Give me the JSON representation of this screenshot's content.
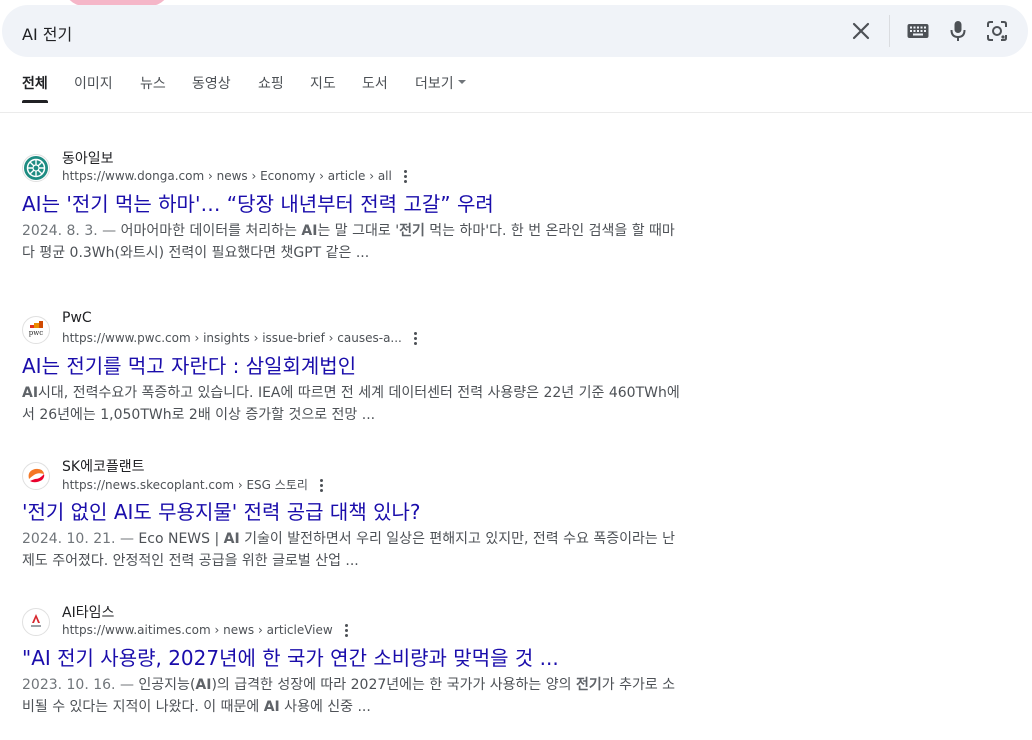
{
  "search": {
    "query": "AI 전기",
    "clear_icon": "close-icon",
    "keyboard_icon": "keyboard-icon",
    "voice_icon": "microphone-icon",
    "lens_icon": "camera-lens-icon"
  },
  "tabs": [
    {
      "label": "전체",
      "active": true
    },
    {
      "label": "이미지"
    },
    {
      "label": "뉴스"
    },
    {
      "label": "동영상"
    },
    {
      "label": "쇼핑"
    },
    {
      "label": "지도"
    },
    {
      "label": "도서"
    },
    {
      "label": "더보기"
    }
  ],
  "results": [
    {
      "site": "동아일보",
      "url_base": "https://www.donga.com",
      "url_path": " › news › Economy › article › all",
      "title": "AI는 '전기 먹는 하마'… “당장 내년부터 전력 고갈” 우려",
      "date": "2024. 8. 3. —",
      "snippet_parts": [
        {
          "t": " 어마어마한 데이터를 처리하는 "
        },
        {
          "t": "AI",
          "b": true
        },
        {
          "t": "는 말 그대로 '"
        },
        {
          "t": "전기",
          "b": true
        },
        {
          "t": " 먹는 하마'다. 한 번 온라인 검색을 할 때마다 평균 0.3Wh(와트시) 전력이 필요했다면 챗GPT 같은 ..."
        }
      ]
    },
    {
      "site": "PwC",
      "url_base": "https://www.pwc.com",
      "url_path": " › insights › issue-brief › causes-a...",
      "title": "AI는 전기를 먹고 자란다 : 삼일회계법인",
      "date": "",
      "snippet_parts": [
        {
          "t": "AI",
          "b": true
        },
        {
          "t": "시대, 전력수요가 폭증하고 있습니다. IEA에 따르면 전 세계 데이터센터 전력 사용량은 22년 기준 460TWh에서 26년에는 1,050TWh로 2배 이상 증가할 것으로 전망 ..."
        }
      ]
    },
    {
      "site": "SK에코플랜트",
      "url_base": "https://news.skecoplant.com",
      "url_path": " › ESG 스토리",
      "title": "'전기 없인 AI도 무용지물' 전력 공급 대책 있나?",
      "date": "2024. 10. 21. —",
      "snippet_parts": [
        {
          "t": " Eco NEWS | "
        },
        {
          "t": "AI",
          "b": true
        },
        {
          "t": " 기술이 발전하면서 우리 일상은 편해지고 있지만, 전력 수요 폭증이라는 난제도 주어졌다. 안정적인 전력 공급을 위한 글로벌 산업 ..."
        }
      ]
    },
    {
      "site": "AI타임스",
      "url_base": "https://www.aitimes.com",
      "url_path": " › news › articleView",
      "title": "\"AI 전기 사용량, 2027년에 한 국가 연간 소비량과 맞먹을 것 ...",
      "date": "2023. 10. 16. —",
      "snippet_parts": [
        {
          "t": " 인공지능("
        },
        {
          "t": "AI",
          "b": true
        },
        {
          "t": ")의 급격한 성장에 따라 2027년에는 한 국가가 사용하는 양의 "
        },
        {
          "t": "전기",
          "b": true
        },
        {
          "t": "가 추가로 소비될 수 있다는 지적이 나왔다. 이 때문에 "
        },
        {
          "t": "AI",
          "b": true
        },
        {
          "t": " 사용에 신중 ..."
        }
      ]
    }
  ],
  "colors": {
    "link": "#1a0dab",
    "search_bg": "#f0f3f8",
    "text_secondary": "#4d5156"
  }
}
